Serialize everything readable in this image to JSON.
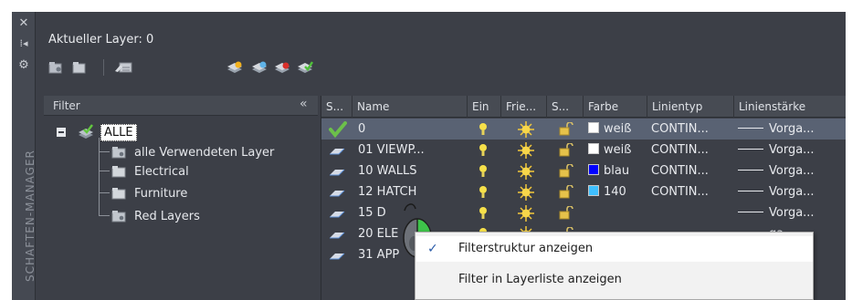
{
  "side_strip": {
    "close_icon": "close-icon",
    "pin_icon": "pin-icon",
    "properties_icon": "gear-icon",
    "title": "SCHAFTEN-MANAGER"
  },
  "header": {
    "current_layer": "Aktueller Layer: 0"
  },
  "toolbar": {
    "icons": [
      "new-property-filter-icon",
      "new-group-filter-icon",
      "layer-states-icon",
      "new-layer-icon",
      "new-vp-frozen-layer-icon",
      "delete-layer-icon",
      "set-current-icon"
    ]
  },
  "filter": {
    "label": "Filter",
    "collapse": "«",
    "tree": [
      {
        "label": "ALLE",
        "level": 0,
        "icon": "all-filter-icon"
      },
      {
        "label": "alle Verwendeten Layer",
        "level": 1,
        "icon": "property-filter-icon"
      },
      {
        "label": "Electrical",
        "level": 1,
        "icon": "group-filter-icon"
      },
      {
        "label": "Furniture",
        "level": 1,
        "icon": "group-filter-icon"
      },
      {
        "label": "Red Layers",
        "level": 1,
        "icon": "property-filter-icon"
      }
    ]
  },
  "table": {
    "columns": [
      "S...",
      "Name",
      "Ein",
      "Frie...",
      "S...",
      "Farbe",
      "Linientyp",
      "Linienstärke"
    ],
    "rows": [
      {
        "status": "current",
        "name": "0",
        "color_name": "weiß",
        "color_hex": "#ffffff",
        "linetype": "CONTIN...",
        "lineweight": "Vorga..."
      },
      {
        "status": "layer",
        "name": "01 VIEWP...",
        "color_name": "weiß",
        "color_hex": "#ffffff",
        "linetype": "CONTIN...",
        "lineweight": "Vorga..."
      },
      {
        "status": "layer",
        "name": "10 WALLS",
        "color_name": "blau",
        "color_hex": "#0000ff",
        "linetype": "CONTIN...",
        "lineweight": "Vorga..."
      },
      {
        "status": "layer",
        "name": "12 HATCH",
        "color_name": "140",
        "color_hex": "#3fbfff",
        "linetype": "CONTIN...",
        "lineweight": "Vorga..."
      },
      {
        "status": "layer",
        "name": "15 D",
        "color_name": "",
        "color_hex": "",
        "linetype": "",
        "lineweight": "Vorga..."
      },
      {
        "status": "layer",
        "name": "20 ELE",
        "color_name": "",
        "color_hex": "",
        "linetype": "",
        "lineweight": "ga..."
      },
      {
        "status": "layer",
        "name": "31 APP",
        "color_name": "",
        "color_hex": "",
        "linetype": "",
        "lineweight": "ga..."
      }
    ]
  },
  "context_menu": {
    "items": [
      {
        "label": "Filterstruktur anzeigen",
        "checked": true
      },
      {
        "label": "Filter in Layerliste anzeigen",
        "checked": false
      }
    ]
  },
  "colors": {
    "panel_bg": "#3c3f47",
    "header_bg": "#474b53",
    "selected_row": "#596273",
    "check_green": "#6cc04a"
  }
}
